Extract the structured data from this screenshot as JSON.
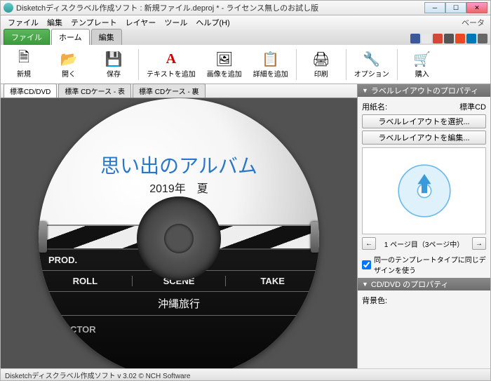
{
  "window": {
    "title": "Disketchディスクラベル作成ソフト : 新規ファイル.deproj * - ライセンス無しのお試し版"
  },
  "menubar": {
    "file": "ファイル",
    "edit": "編集",
    "template": "テンプレート",
    "layer": "レイヤー",
    "tool": "ツール",
    "help": "ヘルプ(H)",
    "beta": "ベータ"
  },
  "ribbon_tabs": {
    "file": "ファイル",
    "home": "ホーム",
    "edit": "編集"
  },
  "share_icons": [
    {
      "name": "facebook",
      "color": "#3b5998"
    },
    {
      "name": "twitter",
      "color": "#e8e8e8"
    },
    {
      "name": "gplus",
      "color": "#d34836"
    },
    {
      "name": "mixi",
      "color": "#555"
    },
    {
      "name": "stumble",
      "color": "#eb4924"
    },
    {
      "name": "linkedin",
      "color": "#0077b5"
    },
    {
      "name": "rss",
      "color": "#666"
    }
  ],
  "toolbar": {
    "new_": "新規",
    "open": "開く",
    "save": "保存",
    "add_text": "テキストを追加",
    "add_image": "画像を追加",
    "add_detail": "詳細を追加",
    "print": "印刷",
    "options": "オプション",
    "purchase": "購入"
  },
  "doc_tabs": {
    "t1": "標準CD/DVD",
    "t2": "標準 CDケース - 表",
    "t3": "標準 CDケース - 裏"
  },
  "disc": {
    "title": "思い出のアルバム",
    "subtitle": "2019年　夏",
    "prod": "PROD.",
    "roll": "ROLL",
    "scene": "SCENE",
    "take": "TAKE",
    "scene_value": "沖縄旅行",
    "director": "DIRECTOR"
  },
  "rightpanel": {
    "layout_header": "ラベルレイアウトのプロパティ",
    "paper_label": "用紙名:",
    "paper_value": "標準CD",
    "select_layout_btn": "ラベルレイアウトを選択...",
    "edit_layout_btn": "ラベルレイアウトを編集...",
    "pager_text": "1 ページ目（3ページ中）",
    "same_design_checkbox": "同一のテンプレートタイプに同じデザインを使う",
    "cddvd_header": "CD/DVD のプロパティ",
    "bgcolor_label": "背景色:"
  },
  "statusbar": {
    "text": "Disketchディスクラベル作成ソフト v 3.02  © NCH Software"
  }
}
